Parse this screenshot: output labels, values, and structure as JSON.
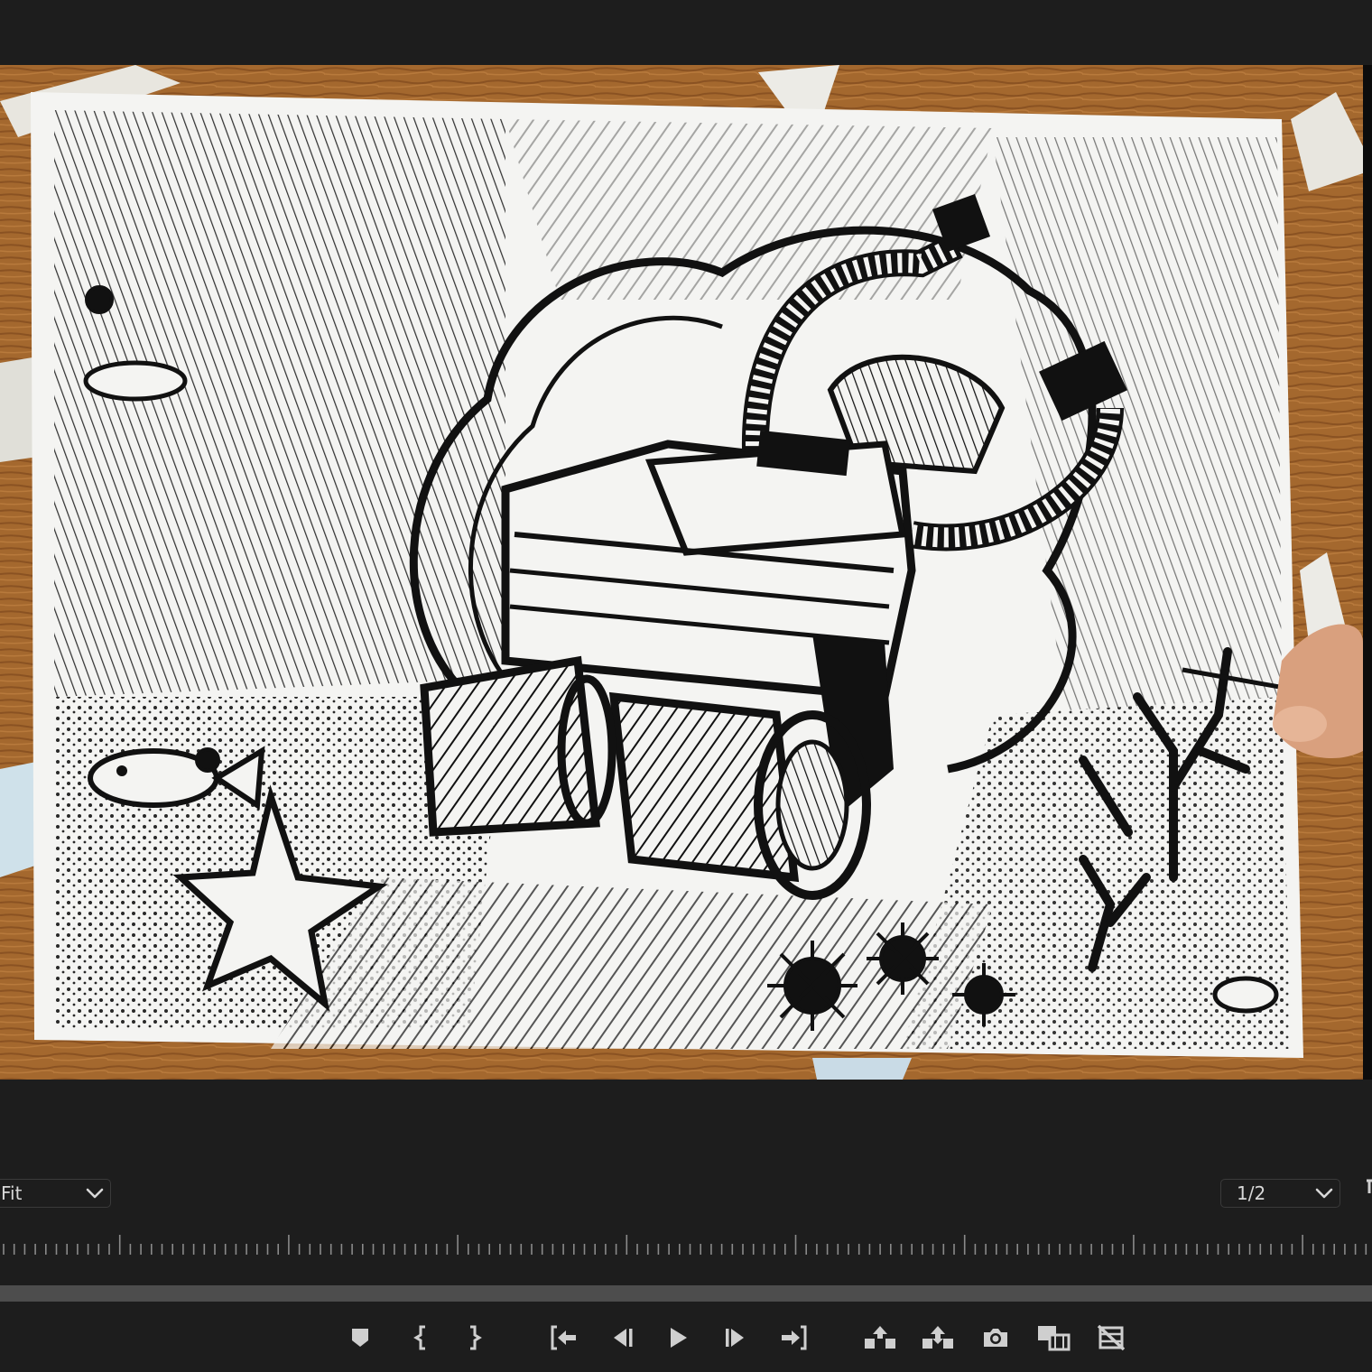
{
  "program_monitor": {
    "zoom_select": {
      "value": "Fit"
    },
    "resolution_select": {
      "value": "1/2"
    }
  },
  "transport_controls": [
    {
      "name": "add-marker-button",
      "icon": "marker-icon"
    },
    {
      "name": "mark-in-button",
      "icon": "mark-in-icon"
    },
    {
      "name": "mark-out-button",
      "icon": "mark-out-icon"
    },
    {
      "name": "go-to-in-button",
      "icon": "go-to-in-icon"
    },
    {
      "name": "step-back-button",
      "icon": "step-back-icon"
    },
    {
      "name": "play-button",
      "icon": "play-icon"
    },
    {
      "name": "step-forward-button",
      "icon": "step-forward-icon"
    },
    {
      "name": "go-to-out-button",
      "icon": "go-to-out-icon"
    },
    {
      "name": "lift-button",
      "icon": "lift-icon"
    },
    {
      "name": "extract-button",
      "icon": "extract-icon"
    },
    {
      "name": "export-frame-button",
      "icon": "camera-icon"
    },
    {
      "name": "comparison-view-button",
      "icon": "comparison-view-icon"
    },
    {
      "name": "toggle-proxies-button",
      "icon": "proxy-off-icon"
    }
  ],
  "colors": {
    "panel": "#1d1d1d",
    "text": "#d8d8d8",
    "icon": "#cfcfcf",
    "scrollbar": "#4d4d4d"
  }
}
